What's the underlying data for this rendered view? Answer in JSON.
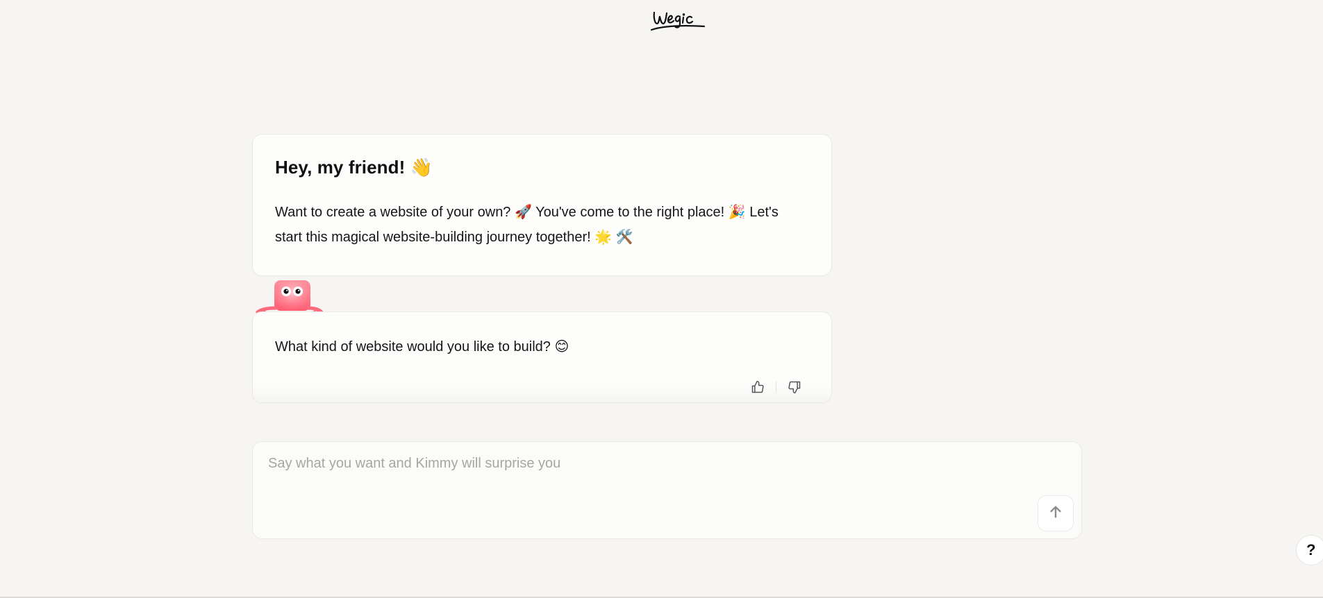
{
  "header": {
    "logo_text": "wegic"
  },
  "chat": {
    "greeting": {
      "title": "Hey, my friend! 👋",
      "body": "Want to create a website of your own? 🚀 You've come to the right place! 🎉 Let's start this magical website-building journey together! 🌟 🛠️"
    },
    "question": {
      "text": "What kind of website would you like to build? 😊",
      "like_icon": "thumbs-up-icon",
      "dislike_icon": "thumbs-down-icon"
    }
  },
  "composer": {
    "placeholder": "Say what you want and Kimmy will surprise you",
    "value": "",
    "send_icon": "arrow-up-icon"
  },
  "help": {
    "label": "?"
  },
  "colors": {
    "background": "#f6f5f3",
    "card": "#fdfdfc",
    "border": "#ebe9e6",
    "mascot": "#ff6b7d",
    "placeholder": "#a8a6a2"
  }
}
